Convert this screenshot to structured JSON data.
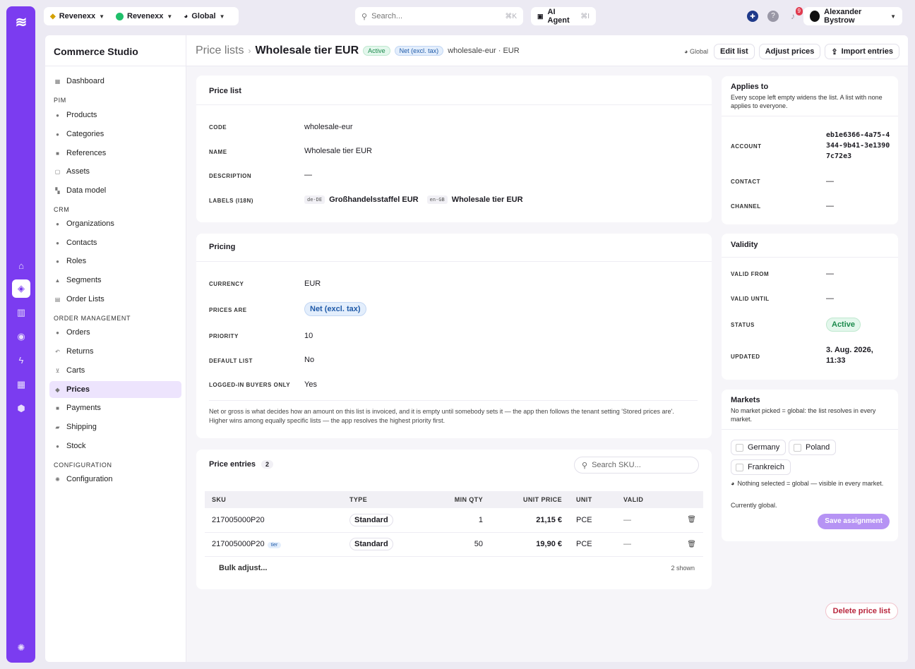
{
  "top": {
    "org": "Revenexx",
    "tenant": "Revenexx",
    "scope": "Global",
    "search_placeholder": "Search...",
    "search_kbd": "⌘K",
    "ai_label": "AI Agent",
    "ai_kbd": "⌘I",
    "notifications": "9",
    "user": "Alexander Bystrow"
  },
  "sidebar": {
    "title": "Commerce Studio",
    "items": {
      "dashboard": "Dashboard",
      "pim": "PIM",
      "products": "Products",
      "categories": "Categories",
      "references": "References",
      "assets": "Assets",
      "data_model": "Data model",
      "crm": "CRM",
      "organizations": "Organizations",
      "contacts": "Contacts",
      "roles": "Roles",
      "segments": "Segments",
      "order_lists": "Order Lists",
      "order_mgmt": "ORDER MANAGEMENT",
      "orders": "Orders",
      "returns": "Returns",
      "carts": "Carts",
      "prices": "Prices",
      "payments": "Payments",
      "shipping": "Shipping",
      "stock": "Stock",
      "configuration_sec": "CONFIGURATION",
      "configuration": "Configuration"
    }
  },
  "header": {
    "parent": "Price lists",
    "title": "Wholesale tier EUR",
    "status": "Active",
    "tax": "Net (excl. tax)",
    "code_ccy": "wholesale-eur · EUR",
    "scope": "Global",
    "edit": "Edit list",
    "adjust": "Adjust prices",
    "import": "Import entries"
  },
  "pricelist": {
    "title": "Price list",
    "code_l": "CODE",
    "code": "wholesale-eur",
    "name_l": "NAME",
    "name": "Wholesale tier EUR",
    "desc_l": "DESCRIPTION",
    "desc": "—",
    "labels_l": "LABELS (I18N)",
    "de_code": "de-DE",
    "de": "Großhandelsstaffel EUR",
    "en_code": "en-GB",
    "en": "Wholesale tier EUR"
  },
  "pricing": {
    "title": "Pricing",
    "currency_l": "CURRENCY",
    "currency": "EUR",
    "prices_are_l": "PRICES ARE",
    "prices_are": "Net (excl. tax)",
    "priority_l": "PRIORITY",
    "priority": "10",
    "default_l": "DEFAULT LIST",
    "default": "No",
    "logged_l": "LOGGED-IN BUYERS ONLY",
    "logged": "Yes",
    "note1": "Net or gross is what decides how an amount on this list is invoiced, and it is empty until somebody sets it — the app then follows the tenant setting 'Stored prices are'.",
    "note2": "Higher wins among equally specific lists — the app resolves the highest priority first."
  },
  "entries": {
    "title": "Price entries",
    "count": "2",
    "search_placeholder": "Search SKU...",
    "cols": [
      "SKU",
      "TYPE",
      "MIN QTY",
      "UNIT PRICE",
      "UNIT",
      "VALID"
    ],
    "rows": [
      {
        "sku": "217005000P20",
        "tier": "",
        "type": "Standard",
        "min": "1",
        "price": "21,15 €",
        "unit": "PCE",
        "valid": "—"
      },
      {
        "sku": "217005000P20",
        "tier": "tier",
        "type": "Standard",
        "min": "50",
        "price": "19,90 €",
        "unit": "PCE",
        "valid": "—"
      }
    ],
    "bulk": "Bulk adjust...",
    "shown": "2 shown"
  },
  "applies": {
    "title": "Applies to",
    "desc": "Every scope left empty widens the list. A list with none applies to everyone.",
    "account_l": "ACCOUNT",
    "account": "eb1e6366-4a75-4344-9b41-3e13907c72e3",
    "contact_l": "CONTACT",
    "contact": "—",
    "channel_l": "CHANNEL",
    "channel": "—"
  },
  "validity": {
    "title": "Validity",
    "from_l": "VALID FROM",
    "from": "—",
    "until_l": "VALID UNTIL",
    "until": "—",
    "status_l": "STATUS",
    "status": "Active",
    "updated_l": "UPDATED",
    "updated": "3. Aug. 2026, 11:33"
  },
  "markets": {
    "title": "Markets",
    "desc": "No market picked = global: the list resolves in every market.",
    "germany": "Germany",
    "poland": "Poland",
    "france": "Frankreich",
    "hint": "Nothing selected = global — visible in every market.",
    "current": "Currently global.",
    "save": "Save assignment"
  },
  "delete": "Delete price list",
  "colors": {
    "accent": "#7b3cf0",
    "active_bg": "#ede4fd",
    "danger": "#b9263d"
  }
}
